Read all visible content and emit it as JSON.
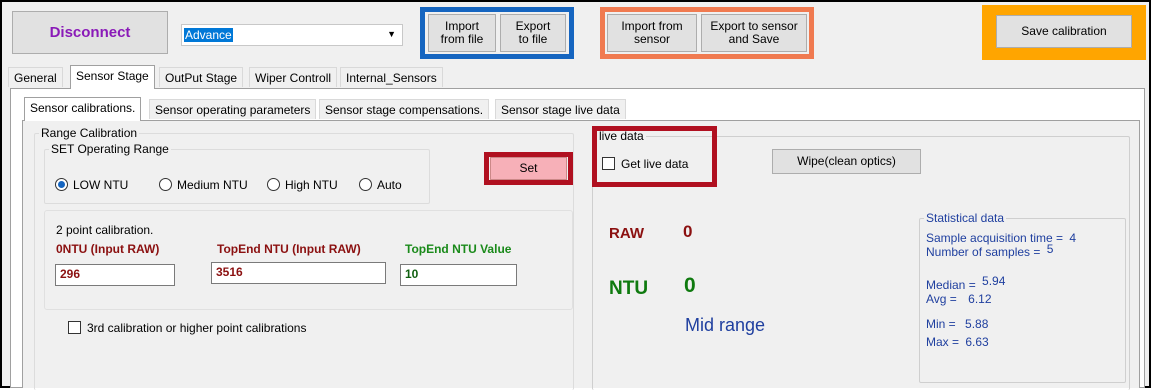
{
  "toolbar": {
    "disconnect_label": "Disconnect",
    "mode_select_value": "Advance",
    "import_file_label": "Import\nfrom file",
    "export_file_label": "Export\nto file",
    "import_sensor_label": "Import from\nsensor",
    "export_sensor_label": "Export to sensor\nand Save",
    "save_calibration_label": "Save calibration"
  },
  "main_tabs": [
    "General",
    "Sensor Stage",
    "OutPut Stage",
    "Wiper Controll",
    "Internal_Sensors"
  ],
  "sub_tabs": [
    "Sensor calibrations.",
    "Sensor operating parameters",
    "Sensor stage compensations.",
    "Sensor stage live data"
  ],
  "range_calibration": {
    "title": "Range Calibration",
    "set_range": {
      "title": "SET Operating Range",
      "options": [
        "LOW NTU",
        "Medium NTU",
        "High NTU",
        "Auto"
      ],
      "selected": "LOW NTU",
      "set_label": "Set"
    },
    "two_point": {
      "title": "2 point calibration.",
      "zero_label": "0NTU (Input RAW)",
      "zero_value": "296",
      "topend_raw_label": "TopEnd NTU (Input RAW)",
      "topend_raw_value": "3516",
      "topend_value_label": "TopEnd NTU Value",
      "topend_value": "10"
    },
    "third_point_label": "3rd calibration or higher point calibrations"
  },
  "live_data": {
    "title": "live data",
    "get_live_label": "Get live data",
    "wipe_label": "Wipe(clean optics)",
    "raw_label": "RAW",
    "raw_value": "0",
    "ntu_label": "NTU",
    "ntu_value": "0",
    "range_text": "Mid range",
    "stats": {
      "title": "Statistical data",
      "acq_label": "Sample acquisition time =",
      "acq_value": "4",
      "samples_label": "Number of samples =",
      "samples_value": "5",
      "median_label": "Median =",
      "median_value": "5.94",
      "avg_label": "Avg =",
      "avg_value": "6.12",
      "min_label": "Min =",
      "min_value": "5.88",
      "max_label": "Max =",
      "max_value": "6.63"
    }
  },
  "colors": {
    "blue_highlight": "#1565c0",
    "orange_highlight": "#f07a50",
    "gold_highlight": "#ffa500",
    "red_highlight": "#b01020",
    "disconnect_text": "#8a1ab8",
    "dark_red_text": "#8b1010",
    "green_text": "#1a8a1a",
    "ntu_green": "#0f7a0f",
    "stats_blue": "#1f3f9f"
  }
}
